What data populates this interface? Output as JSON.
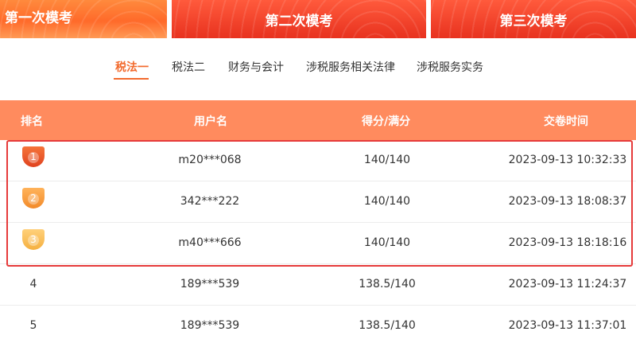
{
  "exam_tabs": [
    {
      "label": "第一次模考"
    },
    {
      "label": "第二次模考"
    },
    {
      "label": "第三次模考"
    }
  ],
  "subject_tabs": [
    {
      "label": "税法一",
      "active": true
    },
    {
      "label": "税法二",
      "active": false
    },
    {
      "label": "财务与会计",
      "active": false
    },
    {
      "label": "涉税服务相关法律",
      "active": false
    },
    {
      "label": "涉税服务实务",
      "active": false
    }
  ],
  "table": {
    "headers": {
      "rank": "排名",
      "username": "用户名",
      "score": "得分/满分",
      "time": "交卷时间"
    },
    "rows": [
      {
        "rank": "1",
        "username": "m20***068",
        "score": "140/140",
        "time": "2023-09-13 10:32:33"
      },
      {
        "rank": "2",
        "username": "342***222",
        "score": "140/140",
        "time": "2023-09-13 18:08:37"
      },
      {
        "rank": "3",
        "username": "m40***666",
        "score": "140/140",
        "time": "2023-09-13 18:18:16"
      },
      {
        "rank": "4",
        "username": "189***539",
        "score": "138.5/140",
        "time": "2023-09-13 11:24:37"
      },
      {
        "rank": "5",
        "username": "189***539",
        "score": "138.5/140",
        "time": "2023-09-13 11:37:01"
      }
    ]
  },
  "colors": {
    "accent": "#f26a2d",
    "header_bg": "#ff8b5e",
    "highlight_border": "#e63a3a"
  },
  "icons": {
    "medal_1": "gold-medal-icon",
    "medal_2": "silver-medal-icon",
    "medal_3": "bronze-medal-icon"
  }
}
